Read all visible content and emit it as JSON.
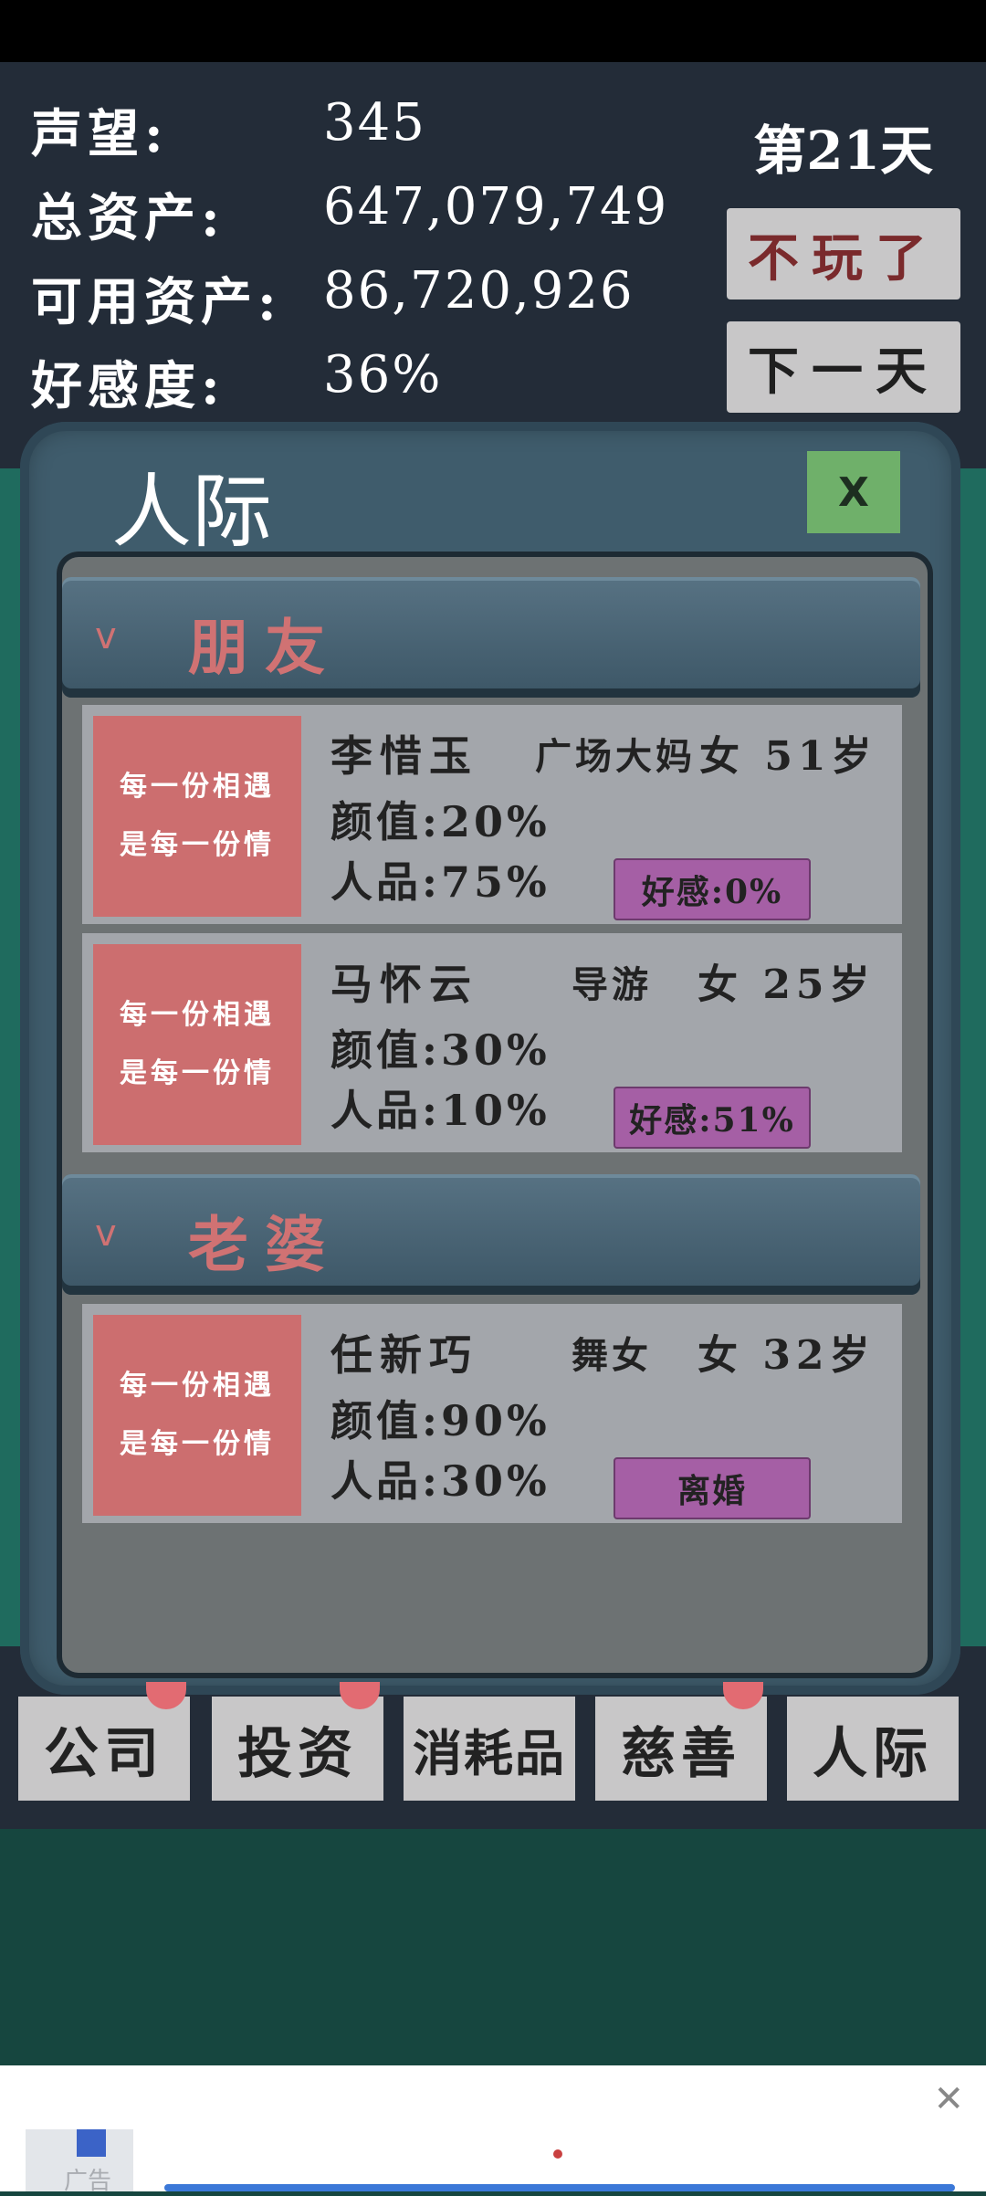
{
  "hud": {
    "stats": [
      {
        "label": "声望:",
        "value": "345"
      },
      {
        "label": "总资产:",
        "value": "647,079,749"
      },
      {
        "label": "可用资产:",
        "value": "86,720,926"
      },
      {
        "label": "好感度:",
        "value": "36%"
      }
    ],
    "day": "第21天",
    "quit_label": "不玩了",
    "next_label": "下一天"
  },
  "panel": {
    "title": "人际",
    "close_label": "X",
    "sections": [
      {
        "chevron": "v",
        "name": "朋友",
        "people": [
          {
            "portrait_line1": "每一份相遇",
            "portrait_line2": "是每一份情",
            "name": "李惜玉",
            "job": "广场大妈",
            "sex_age": "女 51岁",
            "looks": "颜值:20%",
            "moral": "人品:75%",
            "action": "好感:0%"
          },
          {
            "portrait_line1": "每一份相遇",
            "portrait_line2": "是每一份情",
            "name": "马怀云",
            "job": "导游",
            "sex_age": "女 25岁",
            "looks": "颜值:30%",
            "moral": "人品:10%",
            "action": "好感:51%"
          }
        ]
      },
      {
        "chevron": "v",
        "name": "老婆",
        "people": [
          {
            "portrait_line1": "每一份相遇",
            "portrait_line2": "是每一份情",
            "name": "任新巧",
            "job": "舞女",
            "sex_age": "女 32岁",
            "looks": "颜值:90%",
            "moral": "人品:30%",
            "action": "离婚"
          }
        ]
      }
    ]
  },
  "tabs": [
    {
      "label": "公司",
      "badge": true
    },
    {
      "label": "投资",
      "badge": true
    },
    {
      "label": "消耗品",
      "badge": false
    },
    {
      "label": "慈善",
      "badge": true
    },
    {
      "label": "人际",
      "badge": false
    }
  ],
  "ad": {
    "label": "广告",
    "close": "✕"
  },
  "colors": {
    "accent_red": "#d07273",
    "action_purple": "#a55fa5",
    "close_green": "#6fb06a"
  }
}
